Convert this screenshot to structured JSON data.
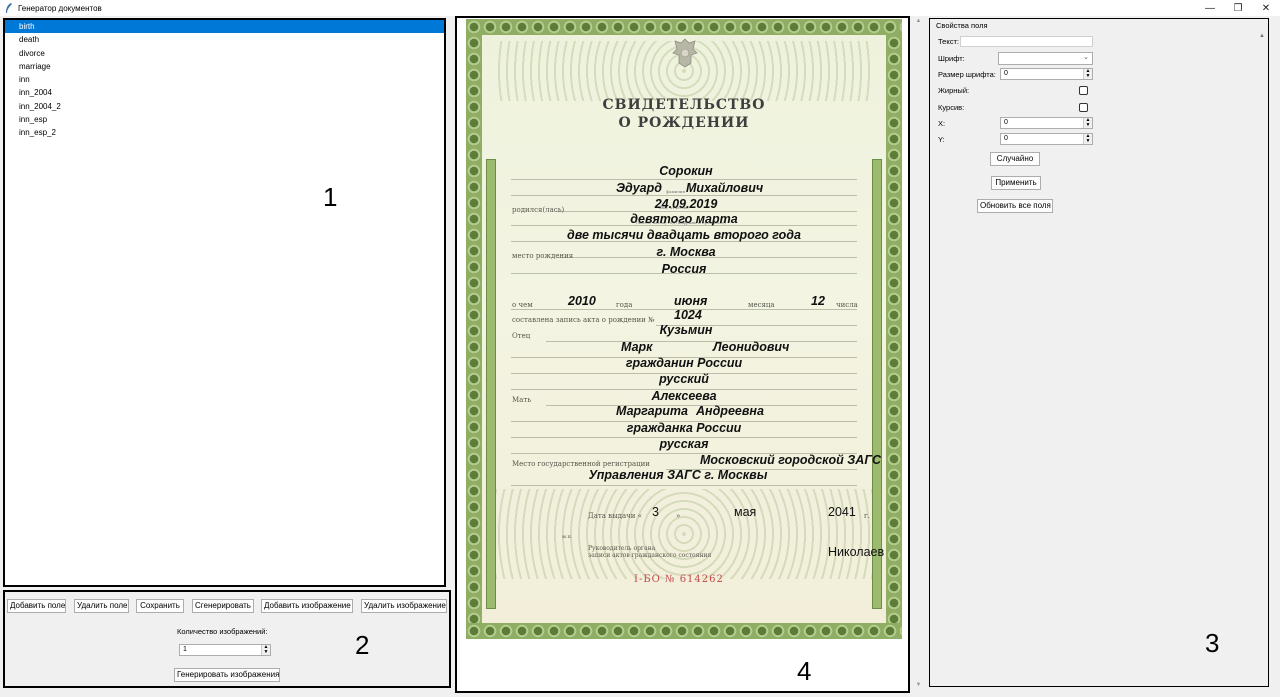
{
  "window": {
    "title": "Генератор документов",
    "minimize": "—",
    "maximize": "❐",
    "close": "✕"
  },
  "panel_numbers": {
    "p1": "1",
    "p2": "2",
    "p3": "3",
    "p4": "4"
  },
  "templates": [
    "birth",
    "death",
    "divorce",
    "marriage",
    "inn",
    "inn_2004",
    "inn_2004_2",
    "inn_esp",
    "inn_esp_2"
  ],
  "selected_template": "birth",
  "toolbar": {
    "add_field": "Добавить поле",
    "remove_field": "Удалить поле",
    "save": "Сохранить",
    "generate": "Сгенерировать",
    "add_image": "Добавить изображение",
    "remove_image": "Удалить изображение",
    "count_label": "Количество изображений:",
    "count_value": "1",
    "generate_images": "Генерировать изображения"
  },
  "properties": {
    "header": "Свойства поля",
    "text_label": "Текст:",
    "text_value": "",
    "font_label": "Шрифт:",
    "font_value": "",
    "size_label": "Размер шрифта:",
    "size_value": "0",
    "bold_label": "Жирный:",
    "italic_label": "Курсив:",
    "x_label": "X:",
    "x_value": "0",
    "y_label": "Y:",
    "y_value": "0",
    "random_button": "Случайно",
    "apply_button": "Применить",
    "update_all_button": "Обновить все поля"
  },
  "certificate": {
    "title_line1": "СВИДЕТЕЛЬСТВО",
    "title_line2": "О РОЖДЕНИИ",
    "surname": "Сорокин",
    "first_name": "Эдуард",
    "patronymic": "Михайлович",
    "birth_date": "24.09.2019",
    "birth_date_words1": "девятого марта",
    "birth_date_words2": "две тысячи двадцать второго года",
    "birth_place": "г. Москва",
    "birth_country": "Россия",
    "record_year": "2010",
    "record_month": "июня",
    "record_day": "12",
    "record_number": "1024",
    "father_surname": "Кузьмин",
    "father_first_name": "Марк",
    "father_patronymic": "Леонидович",
    "father_citizenship": "гражданин России",
    "father_nationality": "русский",
    "mother_surname": "Алексеева",
    "mother_first_name": "Маргарита",
    "mother_patronymic": "Андреевна",
    "mother_citizenship": "гражданка России",
    "mother_nationality": "русская",
    "registry_office1": "Московский городской ЗАГС",
    "registry_office2": "Управления ЗАГС г. Москвы",
    "issue_day": "3",
    "issue_month": "мая",
    "issue_year": "2041",
    "head_name": "Николаев",
    "serial": "I-БО  № 614262",
    "labels": {
      "born": "родился(лась)",
      "birth_place": "место рождения",
      "about": "о чем",
      "year": "года",
      "month": "месяца",
      "day": "числа",
      "record": "составлена запись акта о рождении №",
      "father": "Отец",
      "mother": "Мать",
      "registration": "Место государственной регистрации",
      "issue_date": "Дата выдачи «",
      "quote_close": "»",
      "year_suffix": "г.",
      "mp": "м.п.",
      "head1": "Руководитель органа",
      "head2": "записи актов гражданского состояния"
    }
  }
}
